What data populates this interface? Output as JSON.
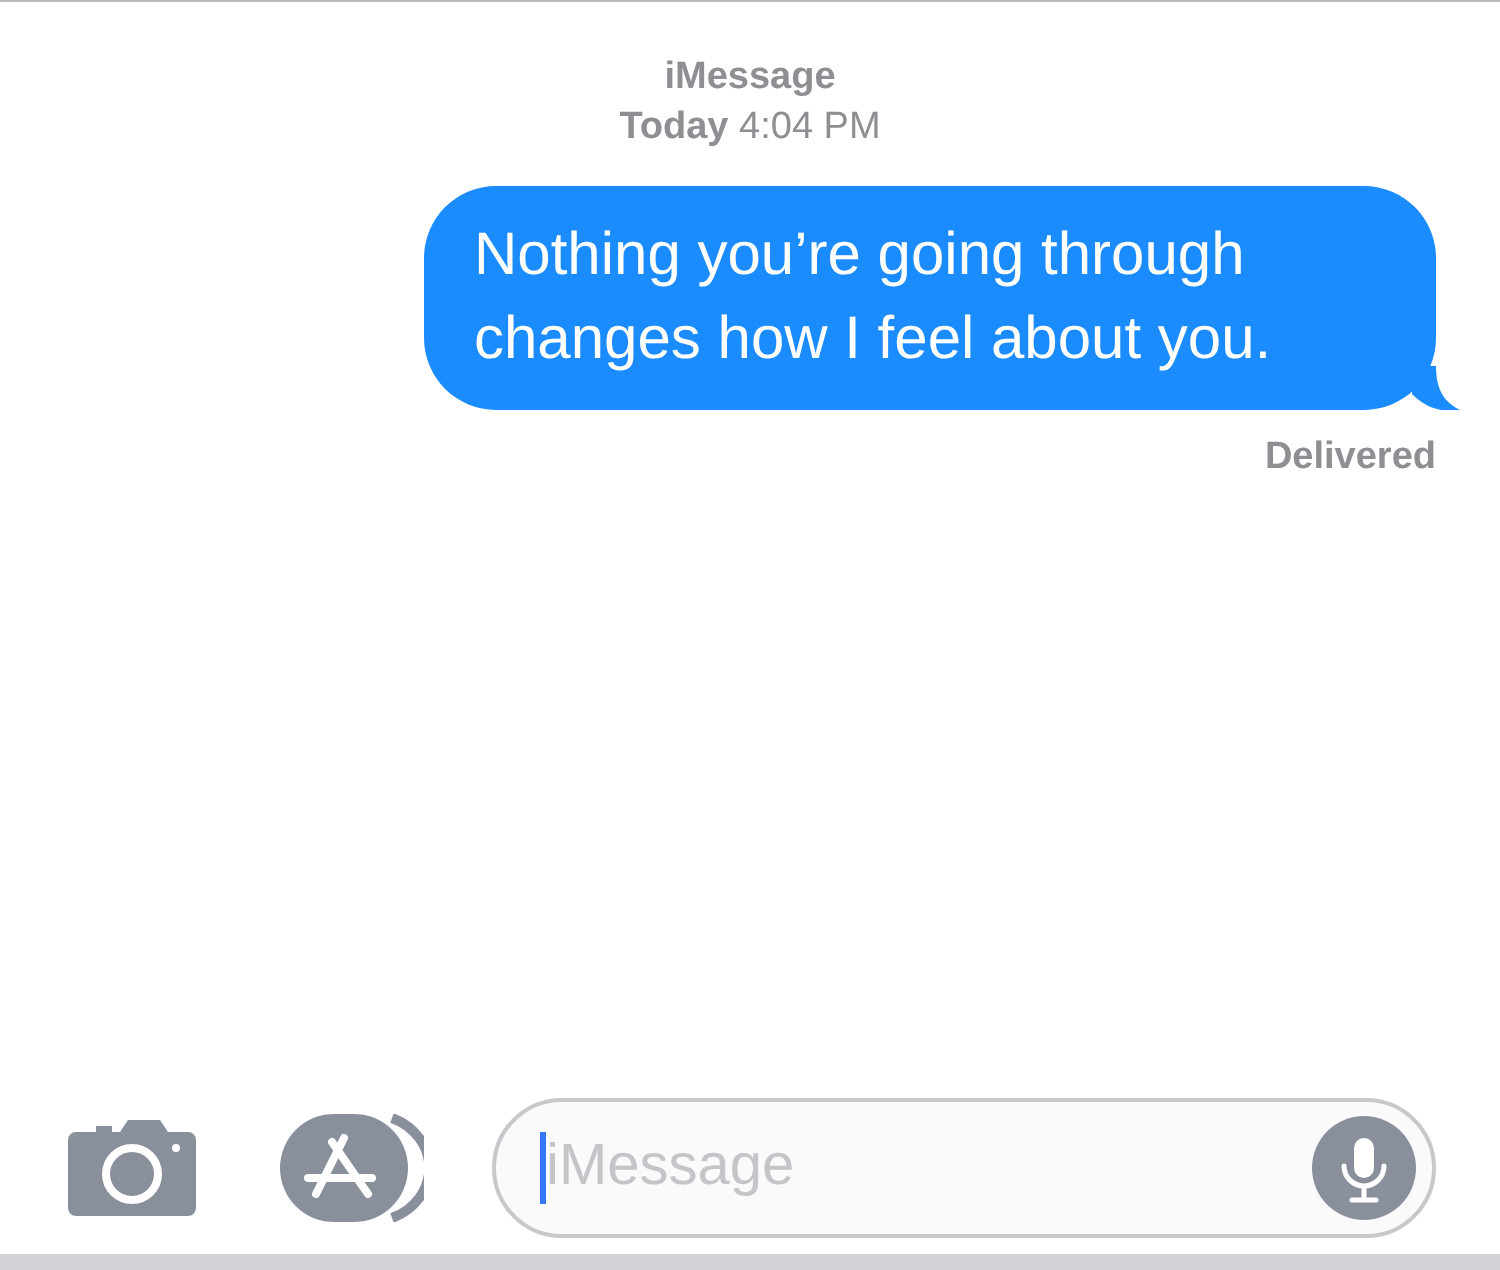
{
  "header": {
    "service": "iMessage",
    "timestamp": "**Today** 4:04 PM"
  },
  "messages": [
    {
      "text": "Nothing you’re going through changes how I feel about you.",
      "outgoing": true,
      "status": "Delivered"
    }
  ],
  "compose": {
    "placeholder": "iMessage"
  }
}
